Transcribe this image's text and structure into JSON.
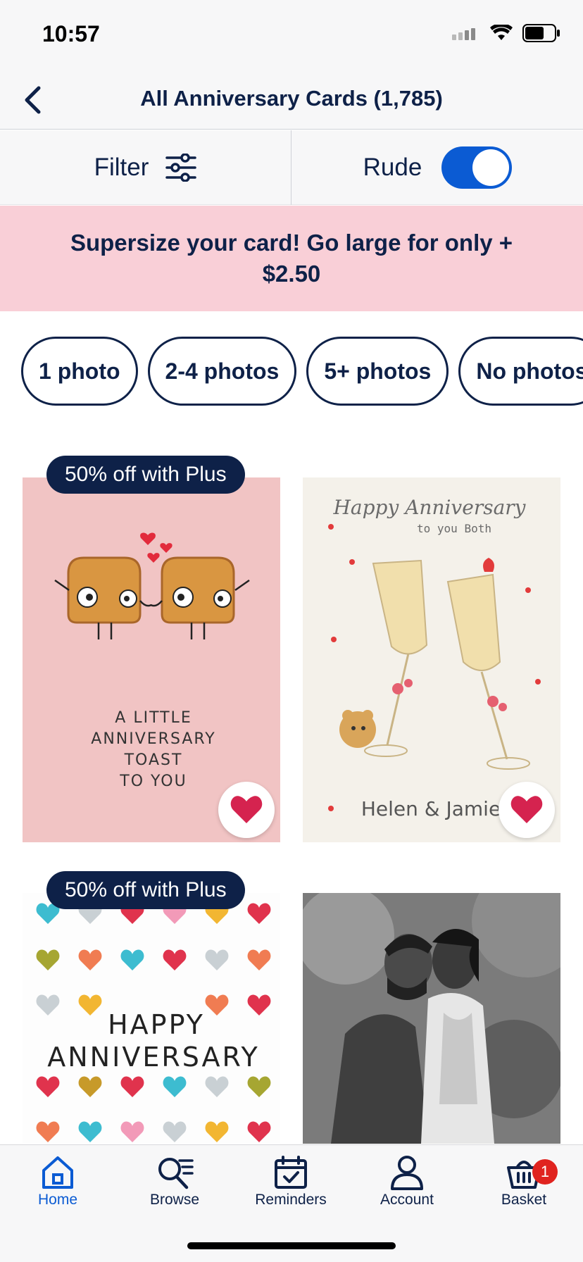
{
  "status_bar": {
    "time": "10:57"
  },
  "header": {
    "title": "All Anniversary Cards (1,785)"
  },
  "filter_bar": {
    "filter_label": "Filter",
    "rude_label": "Rude",
    "rude_enabled": true
  },
  "promo": {
    "text": "Supersize your card! Go large for only + $2.50"
  },
  "chips": [
    "1 photo",
    "2-4 photos",
    "5+ photos",
    "No photos"
  ],
  "cards": [
    {
      "badge": "50% off with Plus",
      "lines": [
        "A LITTLE",
        "ANNIVERSARY",
        "TOAST",
        "TO YOU"
      ],
      "favourited": true
    },
    {
      "script_title": "Happy Anniversary",
      "subtitle": "to you Both",
      "names": "Helen & Jamie",
      "favourited": true
    },
    {
      "badge": "50% off with Plus",
      "line1": "HAPPY",
      "line2": "ANNIVERSARY"
    },
    {
      "description": "black and white wedding photo"
    }
  ],
  "tabs": [
    {
      "label": "Home",
      "icon": "home-icon",
      "active": true
    },
    {
      "label": "Browse",
      "icon": "browse-search-icon"
    },
    {
      "label": "Reminders",
      "icon": "calendar-check-icon"
    },
    {
      "label": "Account",
      "icon": "person-icon"
    },
    {
      "label": "Basket",
      "icon": "basket-icon",
      "badge_count": "1"
    }
  ],
  "colors": {
    "navy": "#0e2148",
    "accent_blue": "#0b5bd3",
    "promo_pink": "#f9cfd7",
    "heart_red": "#d5234f"
  }
}
